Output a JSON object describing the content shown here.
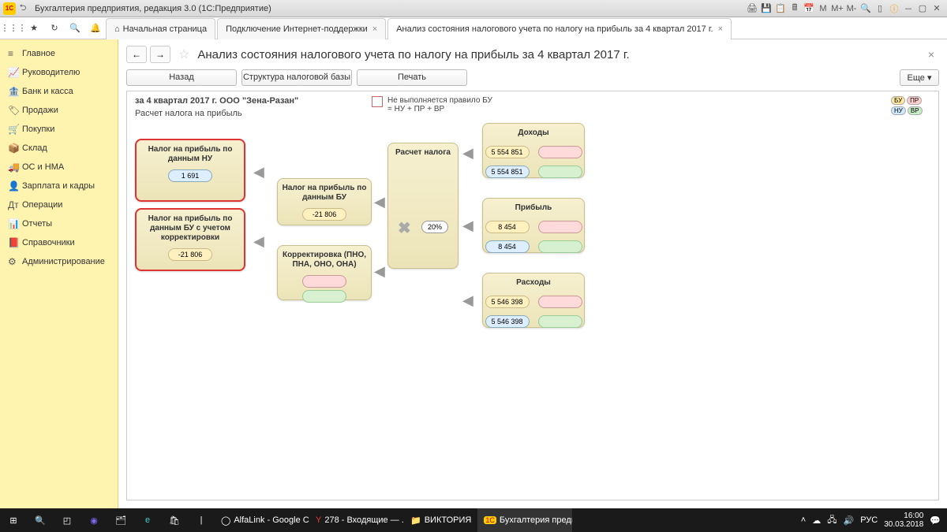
{
  "titlebar": {
    "logo_text": "1C",
    "title": "Бухгалтерия предприятия, редакция 3.0  (1С:Предприятие)",
    "m_labels": [
      "M",
      "M+",
      "M-"
    ]
  },
  "tabs": {
    "home": "Начальная страница",
    "t1": "Подключение Интернет-поддержки",
    "t2": "Анализ состояния налогового учета по налогу на прибыль за 4 квартал 2017 г."
  },
  "sidebar": {
    "items": [
      {
        "icon": "≡",
        "label": "Главное"
      },
      {
        "icon": "📈",
        "label": "Руководителю"
      },
      {
        "icon": "🏦",
        "label": "Банк и касса"
      },
      {
        "icon": "🏷",
        "label": "Продажи"
      },
      {
        "icon": "🛒",
        "label": "Покупки"
      },
      {
        "icon": "📦",
        "label": "Склад"
      },
      {
        "icon": "🚚",
        "label": "ОС и НМА"
      },
      {
        "icon": "👤",
        "label": "Зарплата и кадры"
      },
      {
        "icon": "Дт",
        "label": "Операции"
      },
      {
        "icon": "📊",
        "label": "Отчеты"
      },
      {
        "icon": "📕",
        "label": "Справочники"
      },
      {
        "icon": "⚙",
        "label": "Администрирование"
      }
    ]
  },
  "page": {
    "title": "Анализ состояния налогового учета по налогу на прибыль за 4 квартал 2017 г.",
    "back": "Назад",
    "struct": "Структура налоговой базы",
    "print": "Печать",
    "more": "Еще"
  },
  "report": {
    "period_line": "за 4 квартал 2017 г. ООО \"Зена-Разан\"",
    "subtitle": "Расчет налога на прибыль",
    "legend_text": "Не выполняется правило БУ = НУ + ПР + ВР",
    "lg": {
      "bu": "БУ",
      "pr": "ПР",
      "nu": "НУ",
      "vr": "ВР"
    }
  },
  "blocks": {
    "nalog_nu": {
      "title": "Налог на прибыль по данным НУ",
      "val": "1 691"
    },
    "nalog_bu_corr": {
      "title": "Налог на прибыль по данным БУ с учетом корректировки",
      "val": "-21 806"
    },
    "nalog_bu": {
      "title": "Налог на прибыль по данным БУ",
      "val": "-21 806"
    },
    "corr": {
      "title": "Корректировка (ПНО, ПНА, ОНО, ОНА)"
    },
    "raschet": {
      "title": "Расчет налога",
      "rate": "20%"
    },
    "dohody": {
      "title": "Доходы",
      "v1": "5 554 851",
      "v2": "5 554 851"
    },
    "pribyl": {
      "title": "Прибыль",
      "v1": "8 454",
      "v2": "8 454"
    },
    "rashody": {
      "title": "Расходы",
      "v1": "5 546 398",
      "v2": "5 546 398"
    }
  },
  "taskbar": {
    "tasks": [
      {
        "icon": "C",
        "label": "AlfaLink - Google C..."
      },
      {
        "icon": "Y",
        "label": "278 - Входящие — ..."
      },
      {
        "icon": "📁",
        "label": "ВИКТОРИЯ"
      },
      {
        "icon": "1C",
        "label": "Бухгалтерия предп..."
      }
    ],
    "lang": "РУС",
    "time": "16:00",
    "date": "30.03.2018"
  }
}
